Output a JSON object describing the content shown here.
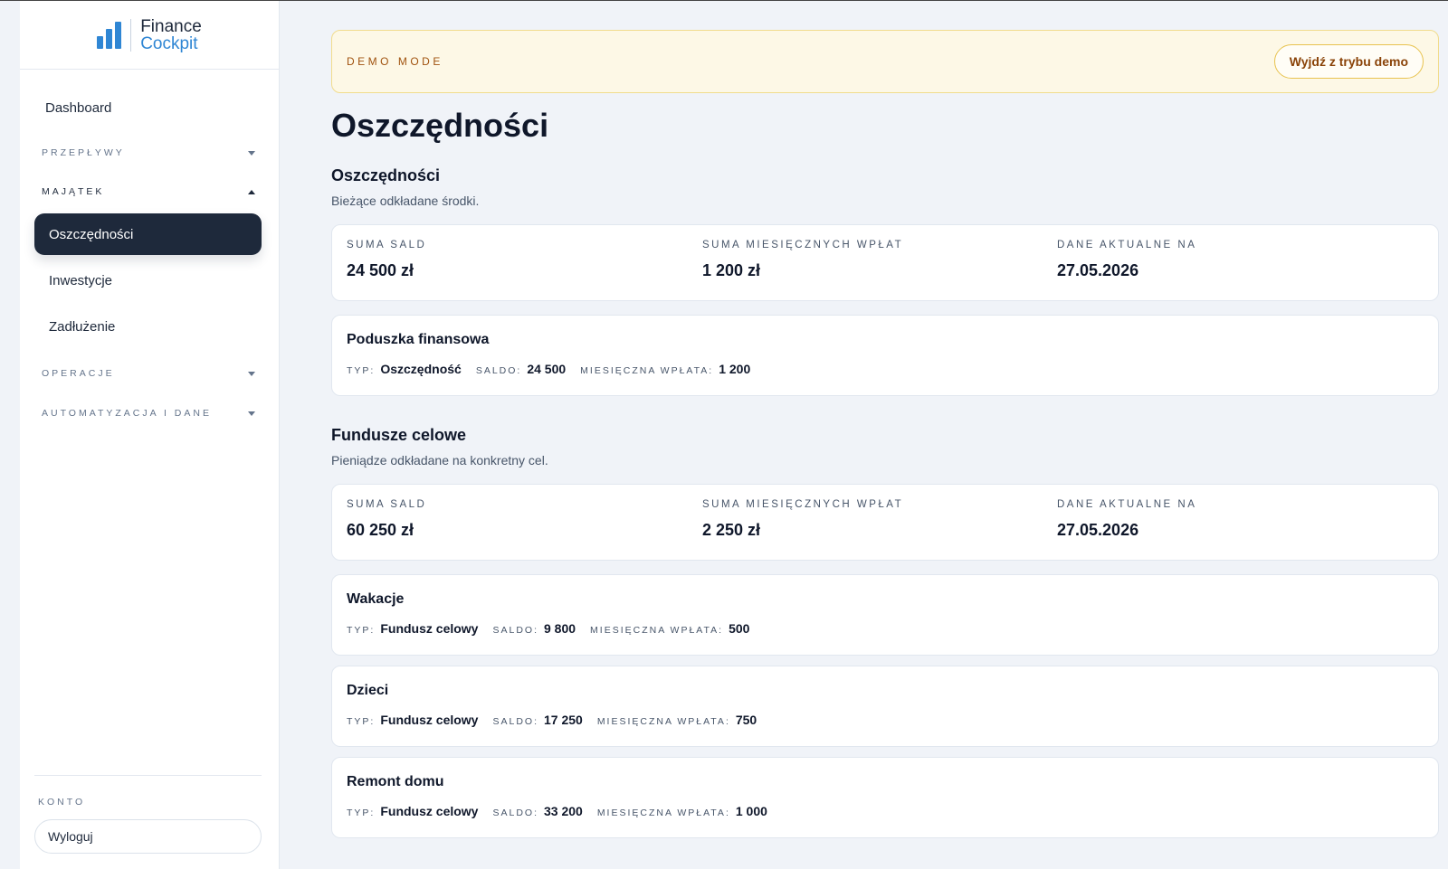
{
  "logo": {
    "line1": "Finance",
    "line2": "Cockpit"
  },
  "nav": {
    "dashboard": "Dashboard",
    "groups": {
      "flows": "PRZEPŁYWY",
      "assets": "MAJĄTEK",
      "operations": "OPERACJE",
      "automation": "AUTOMATYZACJA I DANE"
    },
    "assets_items": [
      "Oszczędności",
      "Inwestycje",
      "Zadłużenie"
    ],
    "active_item": "Oszczędności",
    "account_label": "KONTO",
    "logout": "Wyloguj"
  },
  "demo": {
    "label": "DEMO MODE",
    "exit_button": "Wyjdź z trybu demo"
  },
  "page_title": "Oszczędności",
  "sections": [
    {
      "title": "Oszczędności",
      "subtitle": "Bieżące odkładane środki.",
      "summary": {
        "balance_label": "SUMA SALD",
        "balance_value": "24 500 zł",
        "monthly_label": "SUMA MIESIĘCZNYCH WPŁAT",
        "monthly_value": "1 200 zł",
        "date_label": "DANE AKTUALNE NA",
        "date_value": "27.05.2026"
      },
      "items": [
        {
          "name": "Poduszka finansowa",
          "type_label": "TYP:",
          "type": "Oszczędność",
          "balance_label": "SALDO:",
          "balance": "24 500",
          "monthly_label": "MIESIĘCZNA WPŁATA:",
          "monthly": "1 200"
        }
      ]
    },
    {
      "title": "Fundusze celowe",
      "subtitle": "Pieniądze odkładane na konkretny cel.",
      "summary": {
        "balance_label": "SUMA SALD",
        "balance_value": "60 250 zł",
        "monthly_label": "SUMA MIESIĘCZNYCH WPŁAT",
        "monthly_value": "2 250 zł",
        "date_label": "DANE AKTUALNE NA",
        "date_value": "27.05.2026"
      },
      "items": [
        {
          "name": "Wakacje",
          "type_label": "TYP:",
          "type": "Fundusz celowy",
          "balance_label": "SALDO:",
          "balance": "9 800",
          "monthly_label": "MIESIĘCZNA WPŁATA:",
          "monthly": "500"
        },
        {
          "name": "Dzieci",
          "type_label": "TYP:",
          "type": "Fundusz celowy",
          "balance_label": "SALDO:",
          "balance": "17 250",
          "monthly_label": "MIESIĘCZNA WPŁATA:",
          "monthly": "750"
        },
        {
          "name": "Remont domu",
          "type_label": "TYP:",
          "type": "Fundusz celowy",
          "balance_label": "SALDO:",
          "balance": "33 200",
          "monthly_label": "MIESIĘCZNA WPŁATA:",
          "monthly": "1 000"
        }
      ]
    }
  ],
  "colors": {
    "accent": "#2f86d4",
    "active_nav": "#1e293b",
    "demo_background": "#fdf8e6",
    "demo_text": "#a0520e"
  }
}
